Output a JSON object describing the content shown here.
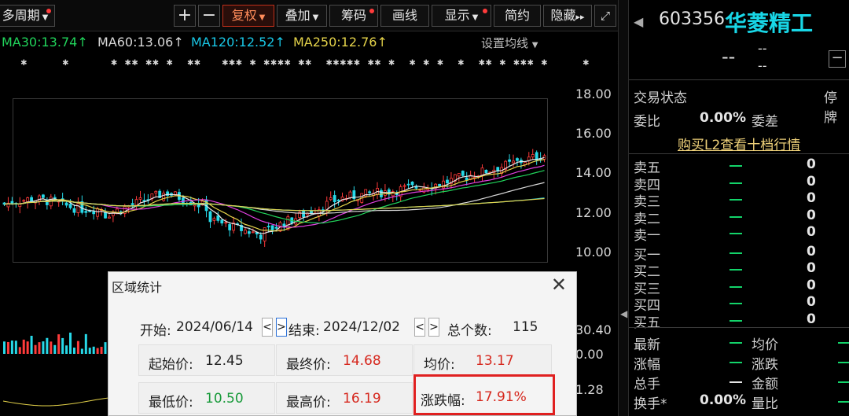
{
  "toolbar": {
    "period": "多周期",
    "plus": "+",
    "minus": "−",
    "adjust": "复权",
    "overlay": "叠加",
    "chips": "筹码",
    "draw": "画线",
    "display": "显示",
    "simple": "简约",
    "hide": "隐藏",
    "hide_arrow": "▸▸"
  },
  "ma": {
    "ma30": "MA30:13.74",
    "ma60": "MA60:13.06",
    "ma120": "MA120:12.52",
    "ma250": "MA250:12.76",
    "arrow": "↑",
    "setting": "设置均线",
    "colors": {
      "ma30": "#21d45b",
      "ma60": "#d9d9d9",
      "ma120": "#19c7e6",
      "ma250": "#e5d34a"
    }
  },
  "yaxis": {
    "labels": [
      "18.00",
      "16.00",
      "14.00",
      "12.00",
      "10.00"
    ],
    "lower": [
      "30.40",
      "0.00",
      "1.28"
    ]
  },
  "right_panel": {
    "code": "603356",
    "name": "华菱精工",
    "price": "--",
    "change1": "--",
    "change2": "--",
    "status_label": "交易状态",
    "status_value": "停牌",
    "weibi_label": "委比",
    "weibi_value": "0.00%",
    "weicha_label": "委差",
    "l2_link": "购买L2查看十档行情",
    "sell": [
      "卖五",
      "卖四",
      "卖三",
      "卖二",
      "卖一"
    ],
    "buy": [
      "买一",
      "买二",
      "买三",
      "买四",
      "买五"
    ],
    "zero": "0",
    "stats_left": [
      "最新",
      "涨幅",
      "总手",
      "换手*"
    ],
    "stats_right": [
      "均价",
      "涨跌",
      "金额",
      "量比"
    ],
    "turnover": "0.00%"
  },
  "dialog": {
    "title": "区域统计",
    "start_label": "开始:",
    "start_date": "2024/06/14",
    "end_label": "结束:",
    "end_date": "2024/12/02",
    "total_label": "总个数:",
    "total": "115",
    "prev": "<",
    "next": ">",
    "open_label": "起始价:",
    "open_value": "12.45",
    "close_label": "最终价:",
    "close_value": "14.68",
    "avg_label": "均价:",
    "avg_value": "13.17",
    "low_label": "最低价:",
    "low_value": "10.50",
    "high_label": "最高价:",
    "high_value": "16.19",
    "chg_label": "涨跌幅:",
    "chg_value": "17.91%",
    "close_x": "✕"
  },
  "chart_data": {
    "type": "candlestick",
    "ylim": [
      9.5,
      18.0
    ],
    "y_ticks": [
      18.0,
      16.0,
      14.0,
      12.0,
      10.0
    ],
    "start_date": "2024/06/14",
    "end_date": "2024/12/02",
    "count": 115,
    "open": 12.45,
    "close": 14.68,
    "low": 10.5,
    "high": 16.19,
    "average": 13.17,
    "change_pct": "17.91%"
  }
}
